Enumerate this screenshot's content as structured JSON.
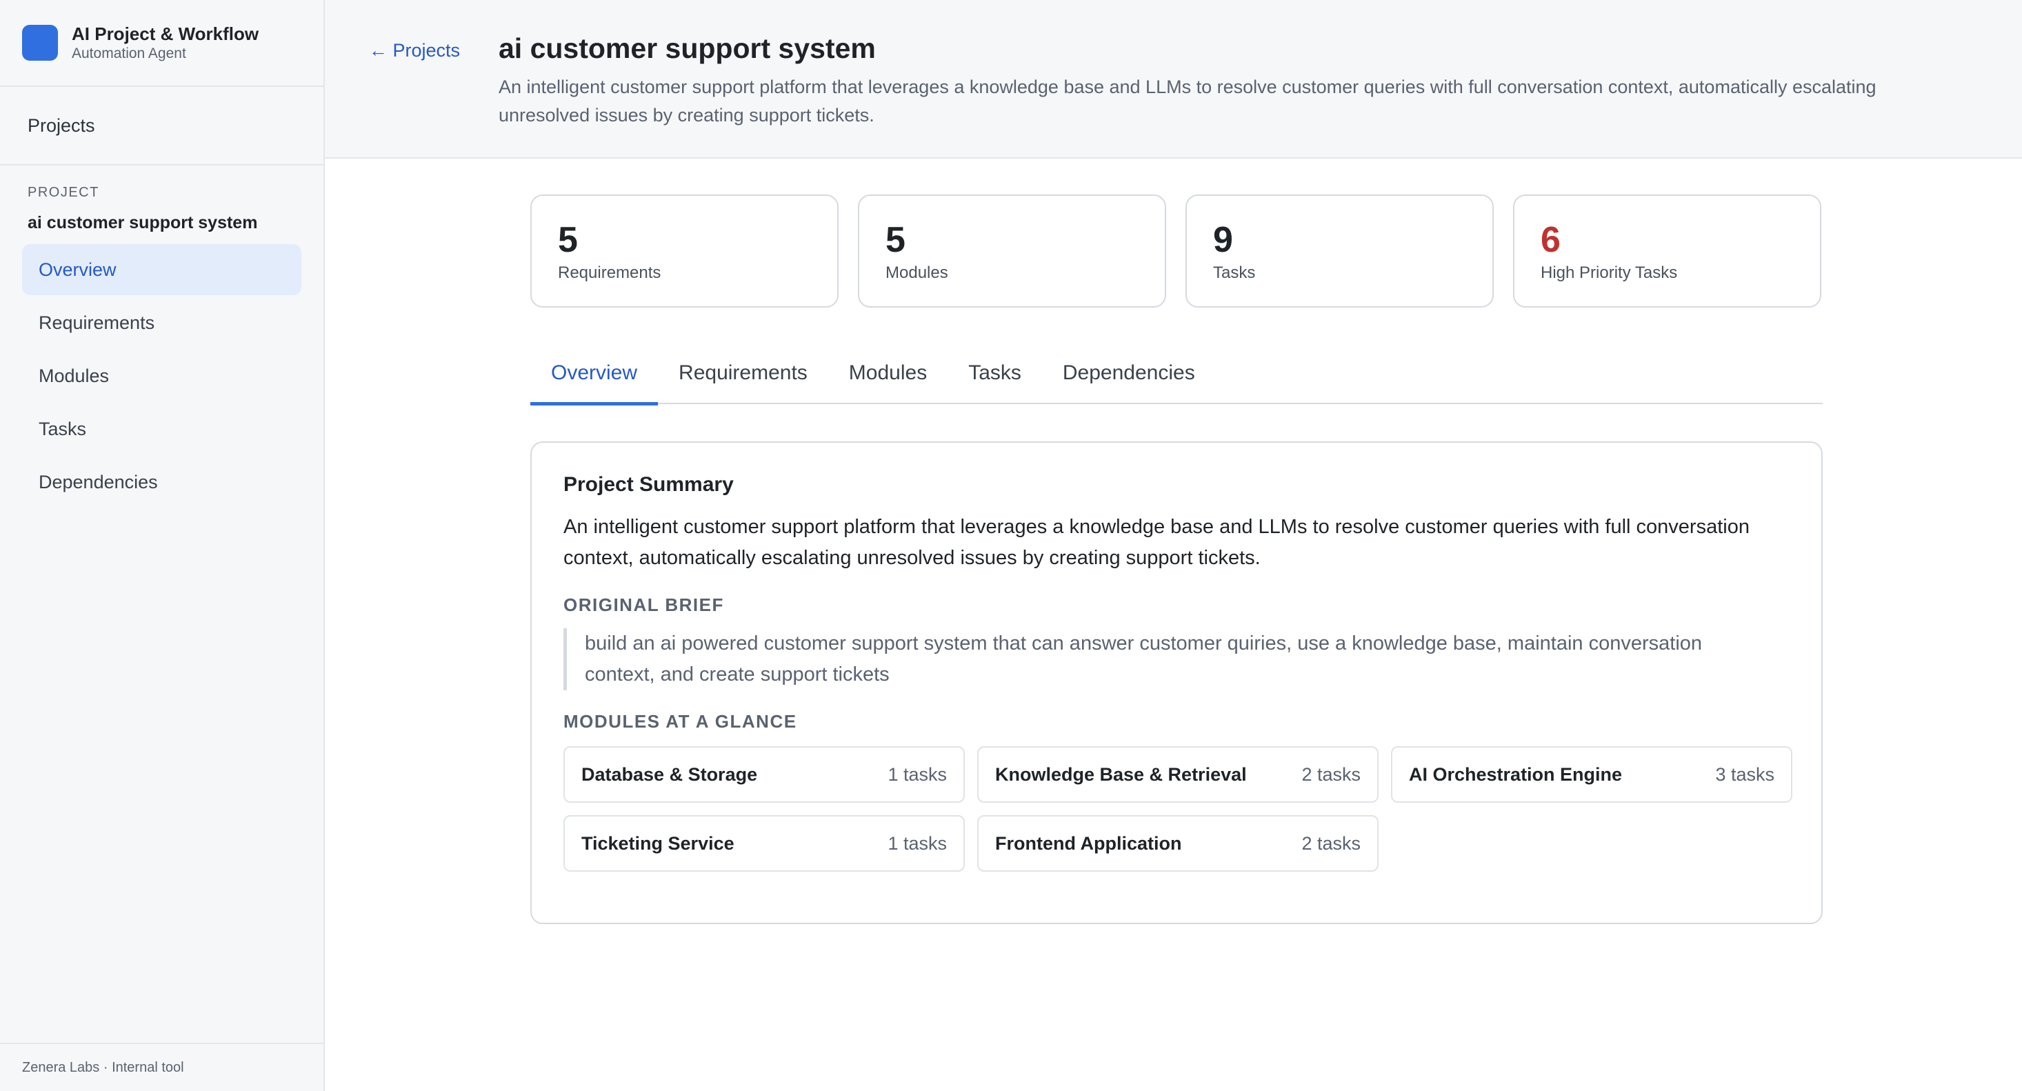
{
  "brand": {
    "title": "AI Project & Workflow",
    "subtitle": "Automation Agent"
  },
  "sidebar": {
    "projects_label": "Projects",
    "project_section_label": "PROJECT",
    "project_name": "ai customer support system",
    "items": [
      {
        "label": "Overview",
        "active": true
      },
      {
        "label": "Requirements"
      },
      {
        "label": "Modules"
      },
      {
        "label": "Tasks"
      },
      {
        "label": "Dependencies"
      }
    ],
    "footer": "Zenera Labs · Internal tool"
  },
  "header": {
    "back_link": "← Projects",
    "title": "ai customer support system",
    "description": "An intelligent customer support platform that leverages a knowledge base and LLMs to resolve customer queries with full conversation context, automatically escalating unresolved issues by creating support tickets."
  },
  "stats": [
    {
      "value": "5",
      "label": "Requirements"
    },
    {
      "value": "5",
      "label": "Modules"
    },
    {
      "value": "9",
      "label": "Tasks"
    },
    {
      "value": "6",
      "label": "High Priority Tasks",
      "color": "#c0312f"
    }
  ],
  "tabs": [
    {
      "label": "Overview",
      "active": true
    },
    {
      "label": "Requirements"
    },
    {
      "label": "Modules"
    },
    {
      "label": "Tasks"
    },
    {
      "label": "Dependencies"
    }
  ],
  "summary": {
    "title": "Project Summary",
    "description": "An intelligent customer support platform that leverages a knowledge base and LLMs to resolve customer queries with full conversation context, automatically escalating unresolved issues by creating support tickets.",
    "brief_label": "ORIGINAL BRIEF",
    "brief": "build an ai powered customer support system that can answer customer quiries, use a knowledge base, maintain conversation context, and create support tickets",
    "modules_label": "MODULES AT A GLANCE",
    "modules": [
      {
        "name": "Database & Storage",
        "count": "1 tasks"
      },
      {
        "name": "Knowledge Base & Retrieval",
        "count": "2 tasks"
      },
      {
        "name": "AI Orchestration Engine",
        "count": "3 tasks"
      },
      {
        "name": "Ticketing Service",
        "count": "1 tasks"
      },
      {
        "name": "Frontend Application",
        "count": "2 tasks"
      }
    ]
  },
  "colors": {
    "accent": "#2f6fdf",
    "danger": "#c0312f"
  }
}
